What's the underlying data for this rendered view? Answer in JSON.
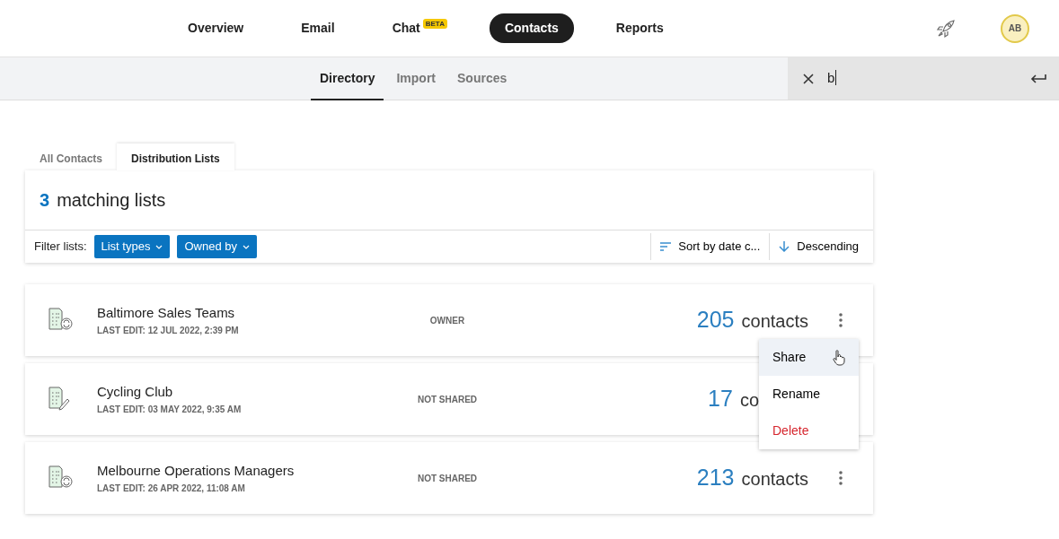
{
  "nav": {
    "items": [
      {
        "label": "Overview",
        "selected": false
      },
      {
        "label": "Email",
        "selected": false
      },
      {
        "label": "Chat",
        "selected": false,
        "badge": "BETA"
      },
      {
        "label": "Contacts",
        "selected": true
      },
      {
        "label": "Reports",
        "selected": false
      }
    ],
    "avatar": "AB"
  },
  "subnav": {
    "tabs": [
      {
        "label": "Directory",
        "selected": true
      },
      {
        "label": "Import",
        "selected": false
      },
      {
        "label": "Sources",
        "selected": false
      }
    ],
    "search": {
      "value": "b"
    }
  },
  "list_tabs": [
    {
      "label": "All Contacts",
      "selected": false
    },
    {
      "label": "Distribution Lists",
      "selected": true
    }
  ],
  "summary": {
    "count": "3",
    "text": "matching lists"
  },
  "filters": {
    "label": "Filter lists:",
    "buttons": [
      "List types",
      "Owned by"
    ]
  },
  "sort": {
    "field": "Sort by date c...",
    "order": "Descending"
  },
  "lists": [
    {
      "kind": "sync",
      "name": "Baltimore Sales Teams",
      "last_edit": "LAST EDIT: 12 JUL 2022, 2:39 PM",
      "sharing": "OWNER",
      "count": "205",
      "unit": "contacts",
      "menu": true
    },
    {
      "kind": "edit",
      "name": "Cycling Club",
      "last_edit": "LAST EDIT: 03 MAY 2022, 9:35 AM",
      "sharing": "NOT SHARED",
      "count": "17",
      "unit": "co",
      "menu": false
    },
    {
      "kind": "sync",
      "name": "Melbourne Operations Managers",
      "last_edit": "LAST EDIT: 26 APR 2022, 11:08 AM",
      "sharing": "NOT SHARED",
      "count": "213",
      "unit": "contacts",
      "menu": true
    }
  ],
  "menu": {
    "items": [
      {
        "label": "Share",
        "selected": true,
        "kind": "normal"
      },
      {
        "label": "Rename",
        "selected": false,
        "kind": "normal"
      },
      {
        "label": "Delete",
        "selected": false,
        "kind": "danger"
      }
    ]
  }
}
